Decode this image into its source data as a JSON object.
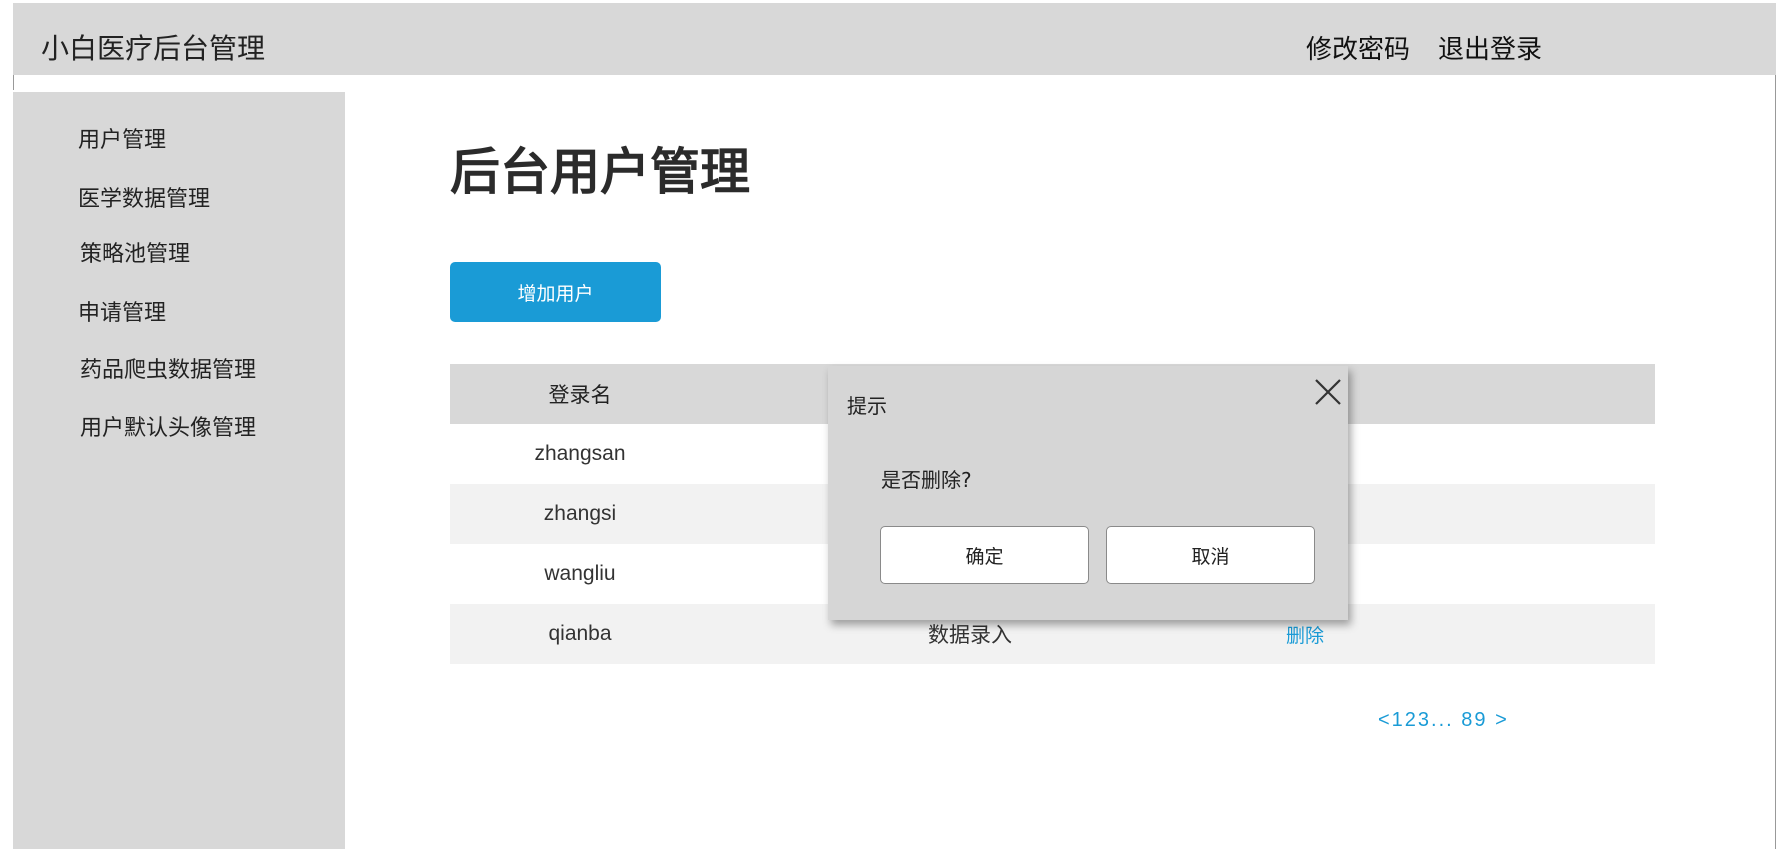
{
  "header": {
    "app_title": "小白医疗后台管理",
    "change_password": "修改密码",
    "logout": "退出登录"
  },
  "sidebar": {
    "items": [
      {
        "label": "用户管理"
      },
      {
        "label": "医学数据管理"
      },
      {
        "label": "策略池管理"
      },
      {
        "label": "申请管理"
      },
      {
        "label": "药品爬虫数据管理"
      },
      {
        "label": "用户默认头像管理"
      }
    ]
  },
  "main": {
    "page_title": "后台用户管理",
    "add_user_button": "增加用户",
    "table": {
      "headers": [
        "登录名"
      ],
      "rows": [
        {
          "login": "zhangsan"
        },
        {
          "login": "zhangsi"
        },
        {
          "login": "wangliu"
        },
        {
          "login": "qianba",
          "role": "数据录入",
          "action": "删除"
        }
      ]
    },
    "pagination": "<123... 89 >"
  },
  "dialog": {
    "title": "提示",
    "message": "是否删除?",
    "confirm": "确定",
    "cancel": "取消",
    "close_icon": "close-icon"
  },
  "colors": {
    "accent": "#1a9bd6",
    "panel_gray": "#d8d8d8",
    "row_alt": "#f2f2f2"
  }
}
